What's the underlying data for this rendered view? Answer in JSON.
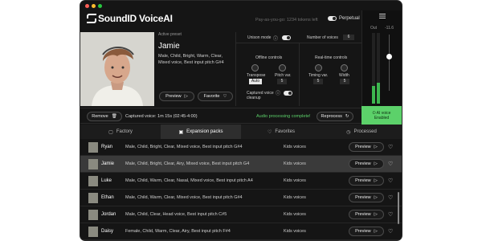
{
  "app": {
    "name": "SoundID VoiceAI"
  },
  "header": {
    "tokens_text": "Pay-as-you-go: 1234 tokens left",
    "perpetual_label": "Perpetual",
    "perpetual_on": true
  },
  "mixer": {
    "out_label": "Out",
    "out_value": "-11.6",
    "meter_levels": [
      0.25,
      0.3
    ]
  },
  "preset": {
    "label": "Active preset",
    "name": "Jamie",
    "tags": "Male, Child, Bright, Warm, Clear, Mixed voice, Best input pitch  G#4",
    "preview_label": "Preview",
    "favorite_label": "Favorite"
  },
  "controls": {
    "unison_label": "Unison mode",
    "unison_on": true,
    "voices_label": "Number of voices",
    "voices_value": "6",
    "offline_title": "Offline controls",
    "transpose_label": "Transpose",
    "transpose_value": "Auto",
    "pitch_var_label": "Pitch var.",
    "pitch_var_value": "5",
    "cleanup_label": "Captured voice cleanup",
    "cleanup_on": true,
    "realtime_title": "Real-time controls",
    "timing_label": "Timing var.",
    "timing_value": "5",
    "width_label": "Width",
    "width_value": "5"
  },
  "capture": {
    "remove_label": "Remove",
    "captured_text": "Captured voice: 1m 15s (02:45-4:00)",
    "status_text": "Audio processing complete!",
    "reprocess_label": "Reprocess",
    "ai_voice_label": "AI voice",
    "ai_voice_state": "Enabled"
  },
  "tabs": [
    {
      "label": "Factory",
      "icon": "grid-icon"
    },
    {
      "label": "Expansion packs",
      "icon": "box-icon",
      "active": true
    },
    {
      "label": "Favorites",
      "icon": "heart-icon"
    },
    {
      "label": "Processed",
      "icon": "clock-icon"
    }
  ],
  "voices": [
    {
      "name": "Ryan",
      "tags": "Male, Child, Bright, Clear, Mixed voice, Best input pitch  G#4",
      "category": "Kids voices",
      "preview": "Preview"
    },
    {
      "name": "Jamie",
      "tags": "Male, Child, Bright, Clear, Airy, Mixed voice, Best input pitch  G4",
      "category": "Kids voices",
      "preview": "Preview",
      "selected": true
    },
    {
      "name": "Luke",
      "tags": "Male, Child, Warm, Clear, Nasal, Mixed voice, Best input pitch  A4",
      "category": "Kids voices",
      "preview": "Preview"
    },
    {
      "name": "Ethan",
      "tags": "Male, Child, Warm, Clear, Mixed voice, Best input pitch  G#4",
      "category": "Kids voices",
      "preview": "Preview"
    },
    {
      "name": "Jordan",
      "tags": "Male, Child, Clear, Head voice, Best input pitch  C#5",
      "category": "Kids voices",
      "preview": "Preview"
    },
    {
      "name": "Daisy",
      "tags": "Female, Child, Warm, Clear, Airy, Best input pitch  F#4",
      "category": "Kids voices",
      "preview": "Preview"
    }
  ]
}
